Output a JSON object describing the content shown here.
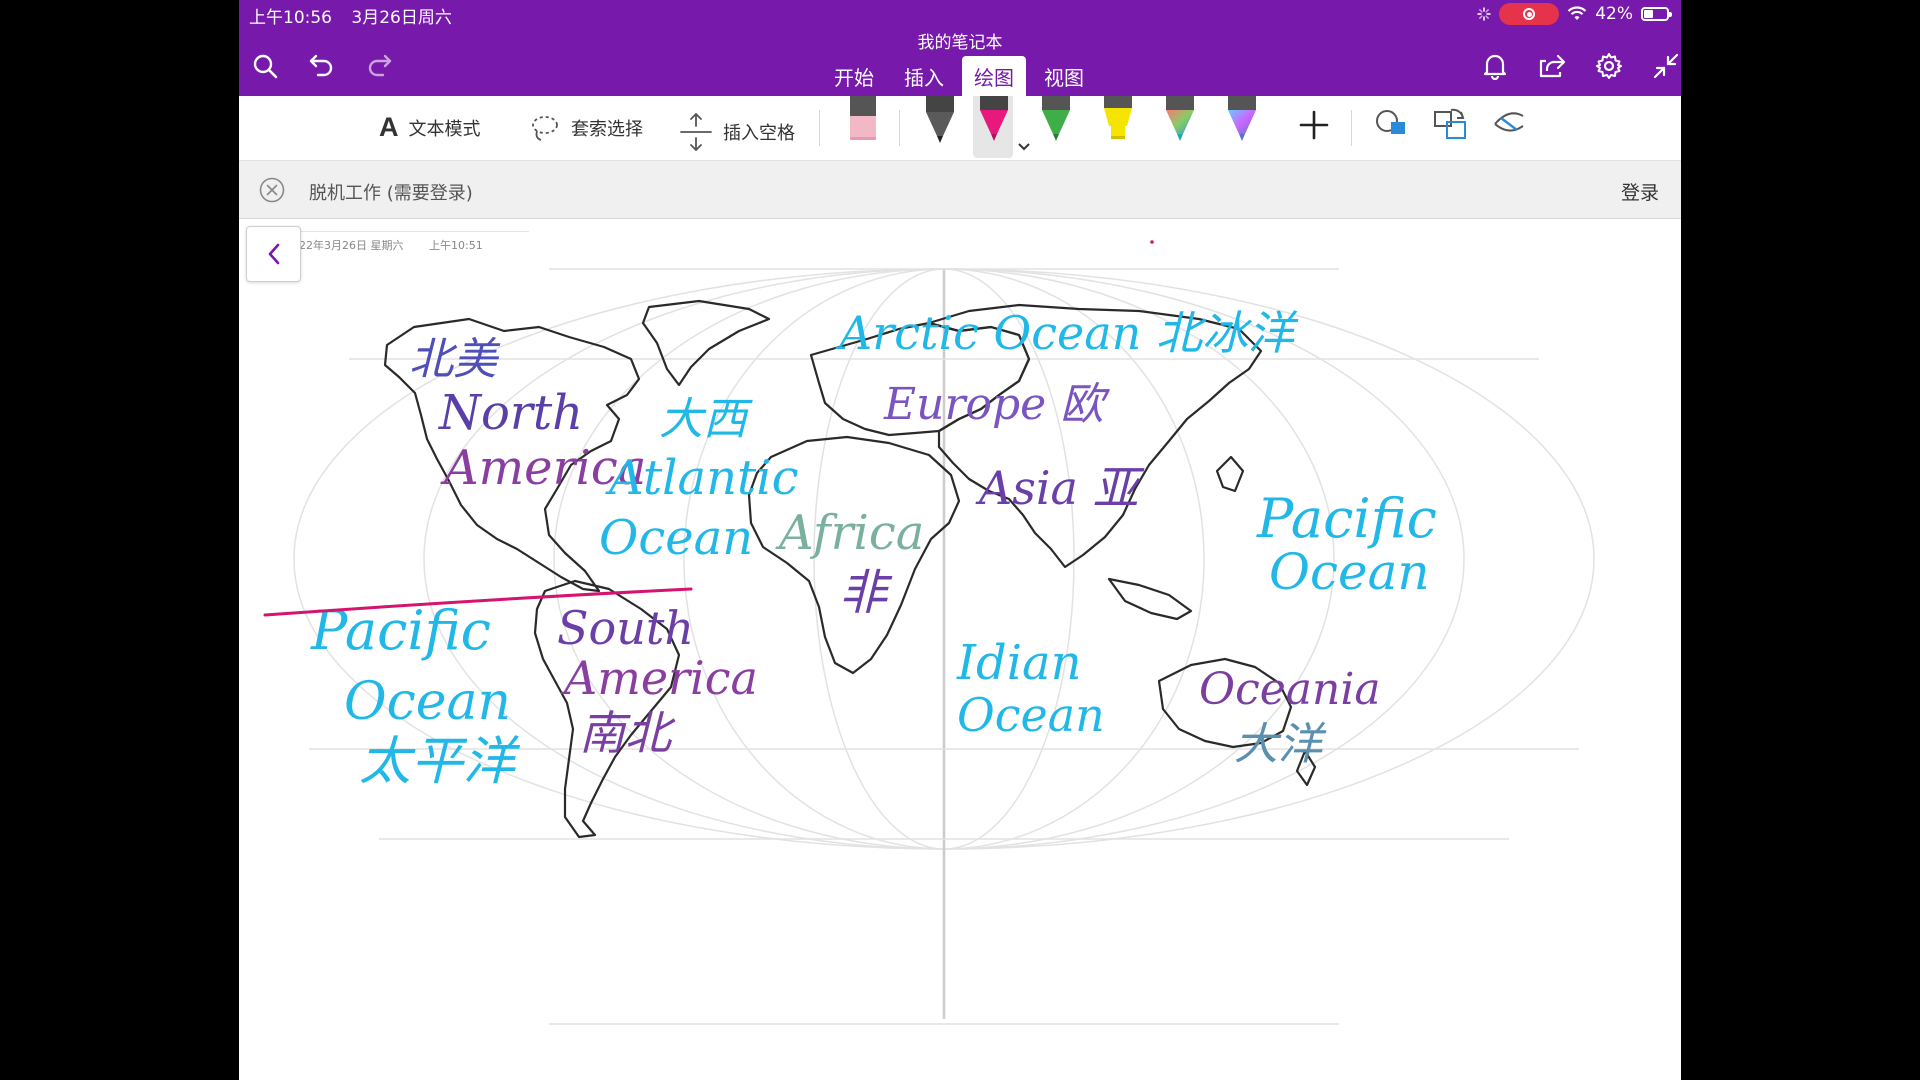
{
  "status": {
    "time": "上午10:56",
    "date": "3月26日周六",
    "battery": "42%",
    "battery_level": 0.42
  },
  "notebook_title": "我的笔记本",
  "tabs": [
    "开始",
    "插入",
    "绘图",
    "视图"
  ],
  "active_tab": "绘图",
  "toolbar": {
    "text_mode": "文本模式",
    "lasso": "套索选择",
    "insert_space": "插入空格",
    "pens": [
      {
        "name": "eraser",
        "color": "#f2b8c6"
      },
      {
        "name": "pen-black",
        "color": "#333333"
      },
      {
        "name": "pen-pink",
        "color": "#e8197d"
      },
      {
        "name": "pen-green",
        "color": "#3fae49"
      },
      {
        "name": "highlighter-yellow",
        "color": "#f5e400"
      },
      {
        "name": "pen-galaxy-teal",
        "color": "#1aa7b8"
      },
      {
        "name": "pen-galaxy-purple",
        "color": "#5b6fd1"
      }
    ]
  },
  "banner": {
    "text": "脱机工作 (需要登录)",
    "signin": "登录"
  },
  "page": {
    "date": "22年3月26日 星期六",
    "time": "上午10:51"
  },
  "ink_labels": {
    "arctic": "Arctic Ocean 北冰洋",
    "north_america_cn": "北美",
    "north_america": "North America",
    "atlantic_cn": "大西",
    "atlantic": "Atlantic Ocean",
    "europe": "Europe 欧",
    "asia": "Asia 亚",
    "africa": "Africa",
    "africa_cn": "非",
    "pacific_right": "Pacific Ocean",
    "pacific_left": "Pacific Ocean 太平洋",
    "south_america": "South America",
    "south_america_cn": "南北",
    "indian": "Idian Ocean",
    "oceania": "Oceania",
    "oceania_cn": "大洋"
  },
  "colors": {
    "brand": "#7719aa",
    "ink_cyan": "#21b8e8",
    "ink_purple": "#6a3fa8",
    "ink_pink": "#d4146e",
    "ink_teal": "#5aa7a0"
  }
}
